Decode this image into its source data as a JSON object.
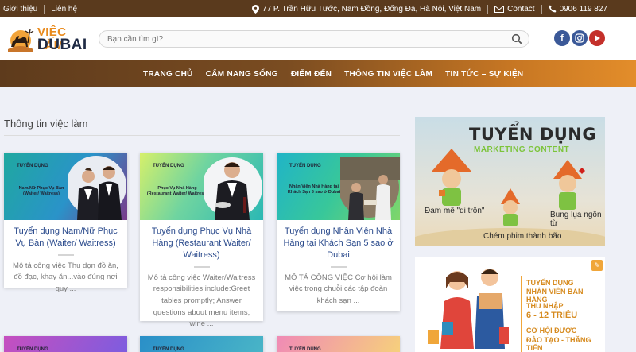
{
  "topbar": {
    "about": "Giới thiệu",
    "contact_link": "Liên hệ",
    "address": "77 P. Trần Hữu Tước, Nam Đồng, Đống Đa, Hà Nội, Việt Nam",
    "contact_label": "Contact",
    "phone": "0906 119 827"
  },
  "logo": {
    "line1": "VIỆC LÀM",
    "line2": "DUBAI"
  },
  "search": {
    "placeholder": "Bạn cần tìm gì?"
  },
  "social": [
    {
      "name": "facebook",
      "glyph": "f",
      "color": "#3b5998"
    },
    {
      "name": "instagram",
      "glyph": "◎",
      "color": "#3b5998"
    },
    {
      "name": "youtube",
      "glyph": "▶",
      "color": "#c4302b"
    }
  ],
  "nav": {
    "items": [
      "TRANG CHỦ",
      "CẨM NANG SỐNG",
      "ĐIỂM ĐẾN",
      "THÔNG TIN VIỆC LÀM",
      "TIN TỨC – SỰ KIỆN"
    ]
  },
  "section": {
    "title": "Thông tin việc làm"
  },
  "cards": [
    {
      "thumb_tag": "TUYỂN DỤNG",
      "thumb_sub": "Nam/Nữ Phục Vụ Bàn (Waiter/ Waitress)",
      "title": "Tuyển dụng Nam/Nữ Phục Vụ Bàn (Waiter/ Waitress)",
      "excerpt": "Mô tả công việc Thu dọn đồ ăn, đồ đạc, khay ăn...vào đúng nơi quy ..."
    },
    {
      "thumb_tag": "TUYỂN DỤNG",
      "thumb_sub": "Phục Vụ Nhà Hàng (Restaurant Waiter/ Waitress)",
      "title": "Tuyển dụng Phục Vụ Nhà Hàng (Restaurant Waiter/ Waitress)",
      "excerpt": "Mô tả công việc Waiter/Waitress responsibilities include:Greet tables promptly; Answer questions about menu items, wine ..."
    },
    {
      "thumb_tag": "TUYỂN DỤNG",
      "thumb_sub": "Nhân Viên Nhà Hàng tại Khách Sạn 5 sao ở Dubai",
      "title": "Tuyển dụng Nhân Viên Nhà Hàng tại Khách Sạn 5 sao ở Dubai",
      "excerpt": "MÔ TẢ CÔNG VIỆC Cơ hội làm việc trong chuỗi các tập đoàn khách sạn ..."
    }
  ],
  "bottom_cards": [
    {
      "thumb_tag": "TUYỂN DỤNG"
    },
    {
      "thumb_tag": "TUYỂN DỤNG"
    },
    {
      "thumb_tag": "TUYỂN DỤNG"
    }
  ],
  "banner_marketing": {
    "heading": "TUYỂN DỤNG",
    "subheading": "MARKETING CONTENT",
    "caption1": "Đam mê \"di trốn\"",
    "caption2": "Bung lụa ngôn từ",
    "caption3": "Chém phim thành bão"
  },
  "banner_sales": {
    "line1": "TUYỂN DỤNG",
    "line2": "NHÂN VIÊN BÁN HÀNG",
    "line3": "THU NHẬP",
    "line4": "6 - 12 TRIỆU",
    "line5": "CƠ HỘI ĐƯỢC",
    "line6": "ĐÀO TẠO - THĂNG TIẾN"
  },
  "colors": {
    "topbar": "#5a3a1d",
    "accent": "#e98b1e",
    "link": "#2a4a8c"
  }
}
